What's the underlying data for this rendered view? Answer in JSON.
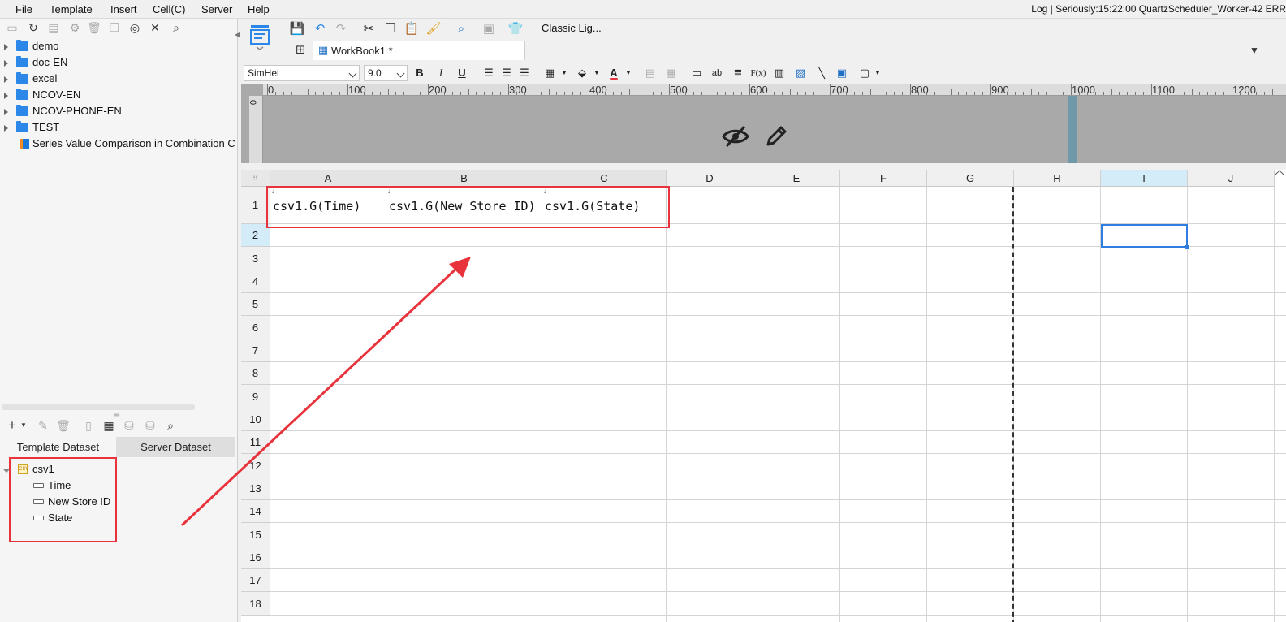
{
  "menu": {
    "items": [
      "File",
      "Template",
      "Insert",
      "Cell(C)",
      "Server",
      "Help"
    ],
    "status": "Log | Seriously:15:22:00 QuartzScheduler_Worker-42 ERR"
  },
  "file_tree": {
    "items": [
      {
        "label": "demo",
        "type": "folder"
      },
      {
        "label": "doc-EN",
        "type": "folder"
      },
      {
        "label": "excel",
        "type": "folder"
      },
      {
        "label": "NCOV-EN",
        "type": "folder"
      },
      {
        "label": "NCOV-PHONE-EN",
        "type": "folder"
      },
      {
        "label": "TEST",
        "type": "folder"
      },
      {
        "label": "Series Value Comparison in Combination Cha",
        "type": "report"
      }
    ]
  },
  "dataset_panel": {
    "tabs": [
      "Template Dataset",
      "Server Dataset"
    ],
    "dataset": {
      "name": "csv1",
      "fields": [
        "Time",
        "New Store ID",
        "State"
      ]
    }
  },
  "toolbar": {
    "theme_label": "Classic Lig..."
  },
  "workbook_tab": {
    "label": "WorkBook1 *"
  },
  "format": {
    "font": "SimHei",
    "size": "9.0",
    "bold": "B",
    "italic": "I",
    "underline": "U",
    "text_icon": "ab",
    "formula_icon": "F(x)"
  },
  "ruler": {
    "labels": [
      "0",
      "100",
      "200",
      "300",
      "400",
      "500",
      "600",
      "700",
      "800",
      "900",
      "1000",
      "1100",
      "1200"
    ],
    "left_label": "0"
  },
  "grid": {
    "columns": [
      "A",
      "B",
      "C",
      "D",
      "E",
      "F",
      "G",
      "H",
      "I",
      "J"
    ],
    "rows": [
      "1",
      "2",
      "3",
      "4",
      "5",
      "6",
      "7",
      "8",
      "9",
      "10",
      "11",
      "12",
      "13",
      "14",
      "15",
      "16",
      "17",
      "18"
    ],
    "cells": [
      {
        "ref": "A1",
        "value": "csv1.G(Time)"
      },
      {
        "ref": "B1",
        "value": "csv1.G(New Store ID)"
      },
      {
        "ref": "C1",
        "value": "csv1.G(State)"
      }
    ],
    "expand_marker": "↓"
  },
  "colors": {
    "accent": "#2f7de1",
    "annotation": "#e8333c",
    "folder": "#2b87e8"
  }
}
